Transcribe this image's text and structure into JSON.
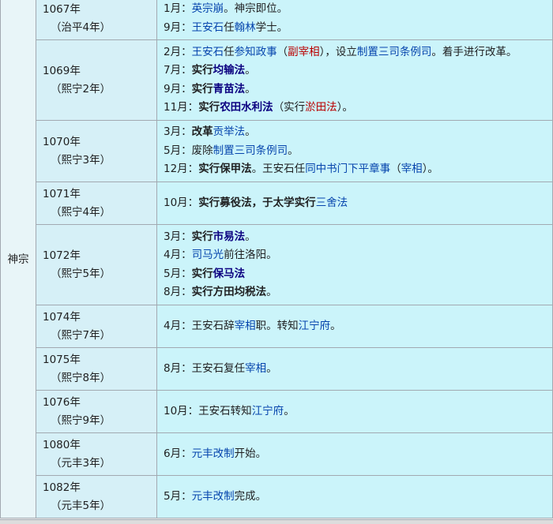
{
  "emperor": "神宗",
  "rows": [
    {
      "year": "1067年",
      "era": "（治平4年）",
      "lines": [
        [
          [
            "n",
            "1月："
          ],
          [
            "b",
            "英宗崩"
          ],
          [
            "n",
            "。神宗即位。"
          ]
        ],
        [
          [
            "n",
            "9月："
          ],
          [
            "b",
            "王安石"
          ],
          [
            "n",
            "任"
          ],
          [
            "b",
            "翰林"
          ],
          [
            "n",
            "学士。"
          ]
        ]
      ]
    },
    {
      "year": "1069年",
      "era": "（熙宁2年）",
      "lines": [
        [
          [
            "n",
            "2月："
          ],
          [
            "b",
            "王安石"
          ],
          [
            "n",
            "任"
          ],
          [
            "b",
            "参知政事"
          ],
          [
            "n",
            "（"
          ],
          [
            "r",
            "副宰相"
          ],
          [
            "n",
            "），设立"
          ],
          [
            "b",
            "制置三司条例司"
          ],
          [
            "n",
            "。着手进行改革。"
          ]
        ],
        [
          [
            "n",
            "7月："
          ],
          [
            "k",
            "实行"
          ],
          [
            "d",
            "均输法"
          ],
          [
            "n",
            "。"
          ]
        ],
        [
          [
            "n",
            "9月："
          ],
          [
            "k",
            "实行"
          ],
          [
            "d",
            "青苗法"
          ],
          [
            "n",
            "。"
          ]
        ],
        [
          [
            "n",
            "11月："
          ],
          [
            "k",
            "实行"
          ],
          [
            "d",
            "农田水利法"
          ],
          [
            "n",
            "（实行"
          ],
          [
            "r",
            "淤田法"
          ],
          [
            "n",
            "）。"
          ]
        ]
      ]
    },
    {
      "year": "1070年",
      "era": "（熙宁3年）",
      "lines": [
        [
          [
            "n",
            "3月："
          ],
          [
            "k",
            "改革"
          ],
          [
            "b",
            "贡举法"
          ],
          [
            "n",
            "。"
          ]
        ],
        [
          [
            "n",
            "5月：废除"
          ],
          [
            "b",
            "制置三司条例司"
          ],
          [
            "n",
            "。"
          ]
        ],
        [
          [
            "n",
            "12月："
          ],
          [
            "k",
            "实行保甲法"
          ],
          [
            "n",
            "。王安石任"
          ],
          [
            "b",
            "同中书门下平章事"
          ],
          [
            "n",
            "（"
          ],
          [
            "b",
            "宰相"
          ],
          [
            "n",
            "）。"
          ]
        ]
      ]
    },
    {
      "year": "1071年",
      "era": "（熙宁4年）",
      "lines": [
        [
          [
            "n",
            "10月："
          ],
          [
            "k",
            "实行募役法，于太学实行"
          ],
          [
            "b",
            "三舍法"
          ]
        ]
      ]
    },
    {
      "year": "1072年",
      "era": "（熙宁5年）",
      "lines": [
        [
          [
            "n",
            "3月："
          ],
          [
            "k",
            "实行"
          ],
          [
            "d",
            "市易法"
          ],
          [
            "n",
            "。"
          ]
        ],
        [
          [
            "n",
            "4月："
          ],
          [
            "b",
            "司马光"
          ],
          [
            "n",
            "前往洛阳。"
          ]
        ],
        [
          [
            "n",
            "5月："
          ],
          [
            "k",
            "实行"
          ],
          [
            "d",
            "保马法"
          ]
        ],
        [
          [
            "n",
            "8月："
          ],
          [
            "k",
            "实行方田均税法"
          ],
          [
            "n",
            "。"
          ]
        ]
      ]
    },
    {
      "year": "1074年",
      "era": "（熙宁7年）",
      "lines": [
        [
          [
            "n",
            "4月：王安石辞"
          ],
          [
            "b",
            "宰相"
          ],
          [
            "n",
            "职。转知"
          ],
          [
            "b",
            "江宁府"
          ],
          [
            "n",
            "。"
          ]
        ]
      ]
    },
    {
      "year": "1075年",
      "era": "（熙宁8年）",
      "lines": [
        [
          [
            "n",
            "8月：王安石复任"
          ],
          [
            "b",
            "宰相"
          ],
          [
            "n",
            "。"
          ]
        ]
      ]
    },
    {
      "year": "1076年",
      "era": "（熙宁9年）",
      "lines": [
        [
          [
            "n",
            "10月：王安石转知"
          ],
          [
            "b",
            "江宁府"
          ],
          [
            "n",
            "。"
          ]
        ]
      ]
    },
    {
      "year": "1080年",
      "era": "（元丰3年）",
      "lines": [
        [
          [
            "n",
            "6月："
          ],
          [
            "b",
            "元丰改制"
          ],
          [
            "n",
            "开始。"
          ]
        ]
      ]
    },
    {
      "year": "1082年",
      "era": "（元丰5年）",
      "lines": [
        [
          [
            "n",
            "5月："
          ],
          [
            "b",
            "元丰改制"
          ],
          [
            "n",
            "完成。"
          ]
        ]
      ]
    }
  ]
}
